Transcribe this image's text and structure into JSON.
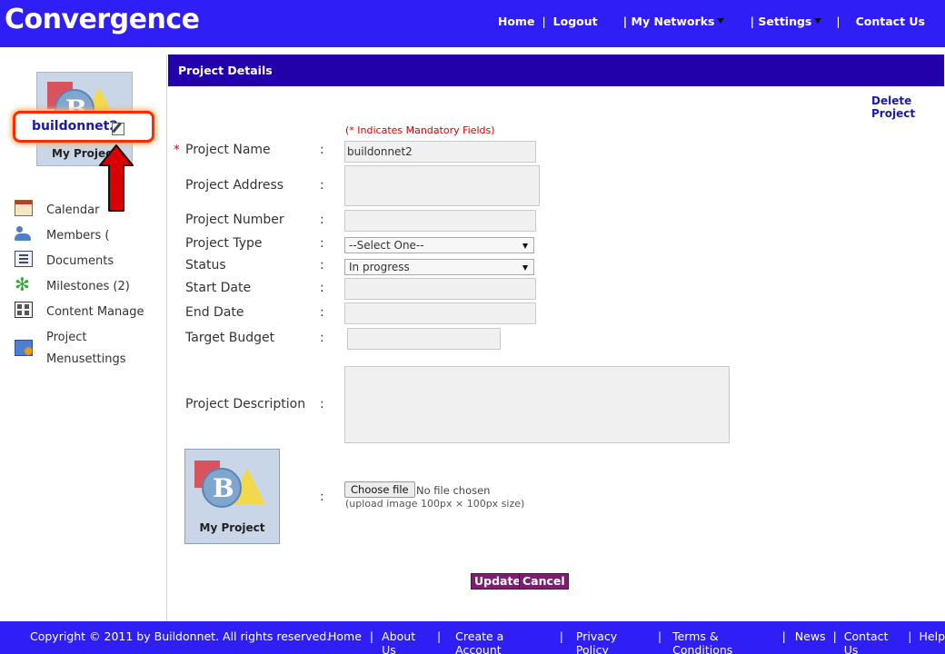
{
  "header": {
    "brand": "Convergence",
    "nav": {
      "home": "Home",
      "logout": "Logout",
      "my_networks": "| My Networks",
      "settings": "| Settings",
      "contact": "Contact Us"
    }
  },
  "sidebar": {
    "thumb_caption": "My Project",
    "project_name": "buildonnet2",
    "menu": {
      "calendar": "Calendar",
      "members": "Members (",
      "documents": "Documents",
      "milestones": "Milestones (2)",
      "content": "Content Manage",
      "menusettings_line1": "Project",
      "menusettings_line2": "Menusettings"
    }
  },
  "panel": {
    "title": "Project Details",
    "delete_link": "Delete Project",
    "mandatory_note": "(* Indicates Mandatory Fields)",
    "required_marker": "*",
    "colon": ":",
    "labels": {
      "name": "Project Name",
      "address": "Project Address",
      "number": "Project Number",
      "type": "Project Type",
      "status": "Status",
      "start": "Start Date",
      "end": "End Date",
      "budget": "Target Budget",
      "description": "Project Description"
    },
    "values": {
      "name": "buildonnet2",
      "type": "--Select One--",
      "status": "In progress"
    },
    "image_caption": "My Project",
    "file_button": "Choose file",
    "no_file": "No file chosen",
    "upload_hint": "(upload image 100px × 100px size)",
    "update_button": "Update",
    "cancel_button": "Cancel"
  },
  "footer": {
    "copyright": "Copyright © 2011 by Buildonnet. All rights reserved.",
    "links": [
      "Home",
      "About Us",
      "Create a Account",
      "Privacy Policy",
      "Terms & Conditions",
      "News",
      "Contact Us",
      "Help"
    ]
  },
  "colors": {
    "brand_blue": "#2f1ff6",
    "panel_header": "#2200aa",
    "button": "#7c1f6e",
    "highlight": "#ff2a00"
  }
}
